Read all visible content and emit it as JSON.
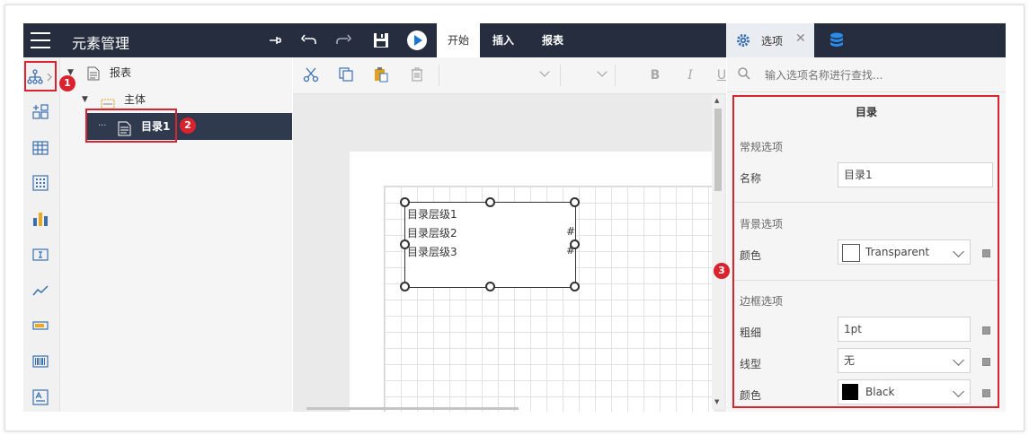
{
  "header": {
    "title": "元素管理",
    "tabs": [
      {
        "label": "开始"
      },
      {
        "label": "插入"
      },
      {
        "label": "报表"
      }
    ],
    "right_tab_label": "选项",
    "close_glyph": "✕"
  },
  "tree": {
    "items": [
      {
        "label": "报表"
      },
      {
        "label": "主体"
      },
      {
        "label": "目录1",
        "prefix": "···"
      }
    ]
  },
  "editor": {
    "format_buttons": [
      "B",
      "I",
      "U"
    ],
    "toc_lines": [
      "目录层级1",
      "目录层级2",
      "目录层级3"
    ],
    "toc_hash": [
      "#",
      "#"
    ]
  },
  "panel": {
    "search_placeholder": "输入选项名称进行查找...",
    "heading": "目录",
    "general_section": "常规选项",
    "name_label": "名称",
    "name_value": "目录1",
    "background_section": "背景选项",
    "bg_color_label": "颜色",
    "bg_color_value": "Transparent",
    "border_section": "边框选项",
    "thickness_label": "粗细",
    "thickness_value": "1pt",
    "linetype_label": "线型",
    "linetype_value": "无",
    "border_color_label": "颜色",
    "border_color_value": "Black"
  },
  "badges": [
    "1",
    "2",
    "3"
  ],
  "colors": {
    "topbar": "#252d3f",
    "accent_red": "#d9232e",
    "selected_row": "#2f3a4e",
    "play_blue": "#1976d2"
  }
}
